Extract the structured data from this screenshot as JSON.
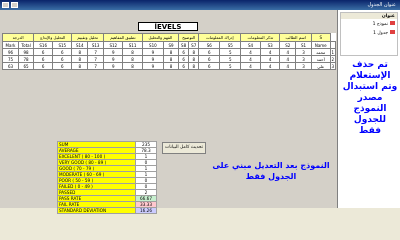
{
  "window": {
    "title": "عنوان الجدول"
  },
  "nav": {
    "header": "عنوان",
    "items": [
      {
        "label": "نموذج 1"
      },
      {
        "label": "جدول 1"
      }
    ]
  },
  "form": {
    "title": "lEVELS",
    "grid_headers": [
      "S",
      "اسم الطالب",
      "تذكر المعلومات",
      "إدراك المعلومات",
      "التوضيح",
      "الفهم والتحليل",
      "تطبيق المفاهيم",
      "تحليل وتقييم",
      "التحليل والإبداع",
      "الدرجة"
    ],
    "grid_sub": [
      "",
      "Name",
      "S1",
      "S2",
      "S3",
      "S4",
      "S5",
      "S6",
      "S7",
      "S8",
      "S9",
      "S10",
      "S11",
      "S12",
      "S13",
      "S14",
      "S15",
      "S16",
      "Total",
      "Mark"
    ],
    "rows": [
      {
        "id": "1",
        "name": "محمد",
        "scores": [
          "3",
          "4",
          "4",
          "4",
          "5",
          "6",
          "8",
          "6",
          "8",
          "9",
          "8",
          "9",
          "7",
          "8",
          "6",
          "6"
        ],
        "total": "98",
        "mark": "96"
      },
      {
        "id": "2",
        "name": "أحمد",
        "scores": [
          "3",
          "4",
          "4",
          "4",
          "5",
          "6",
          "8",
          "6",
          "8",
          "9",
          "8",
          "9",
          "7",
          "8",
          "6",
          "6"
        ],
        "total": "78",
        "mark": "75"
      },
      {
        "id": "3",
        "name": "علي",
        "scores": [
          "3",
          "4",
          "4",
          "4",
          "5",
          "6",
          "8",
          "6",
          "8",
          "9",
          "8",
          "9",
          "7",
          "8",
          "6",
          "6"
        ],
        "total": "65",
        "mark": "63"
      }
    ],
    "stats": [
      {
        "label": "SUM",
        "value": "235"
      },
      {
        "label": "AVERAGE",
        "value": "78.3"
      },
      {
        "label": "EXCELENT ( 80 - 100 )",
        "value": "1"
      },
      {
        "label": "VERY GOOD ( 80 - 89 )",
        "value": "0"
      },
      {
        "label": "GOOD ( 70 - 79 )",
        "value": "1"
      },
      {
        "label": "MODERATE ( 60 - 69 )",
        "value": "1"
      },
      {
        "label": "POOR ( 50 - 59 )",
        "value": "0"
      },
      {
        "label": "FAILED ( 0 - 49 )",
        "value": "0"
      },
      {
        "label": "PASSED",
        "value": "2"
      },
      {
        "label": "PASS RATE",
        "value": "66.67"
      },
      {
        "label": "FAIL RATE",
        "value": "33.33"
      },
      {
        "label": "STANDARD DEVIATION",
        "value": "16.26"
      }
    ],
    "refresh_label": "تحديث كامل البيانات",
    "note_center": "النموذج بعد التعديل مبني على الجدول فقط",
    "note_right": "تم حذف الإستعلام وتم استبدال مصدر النموذج للجدول فقط"
  }
}
